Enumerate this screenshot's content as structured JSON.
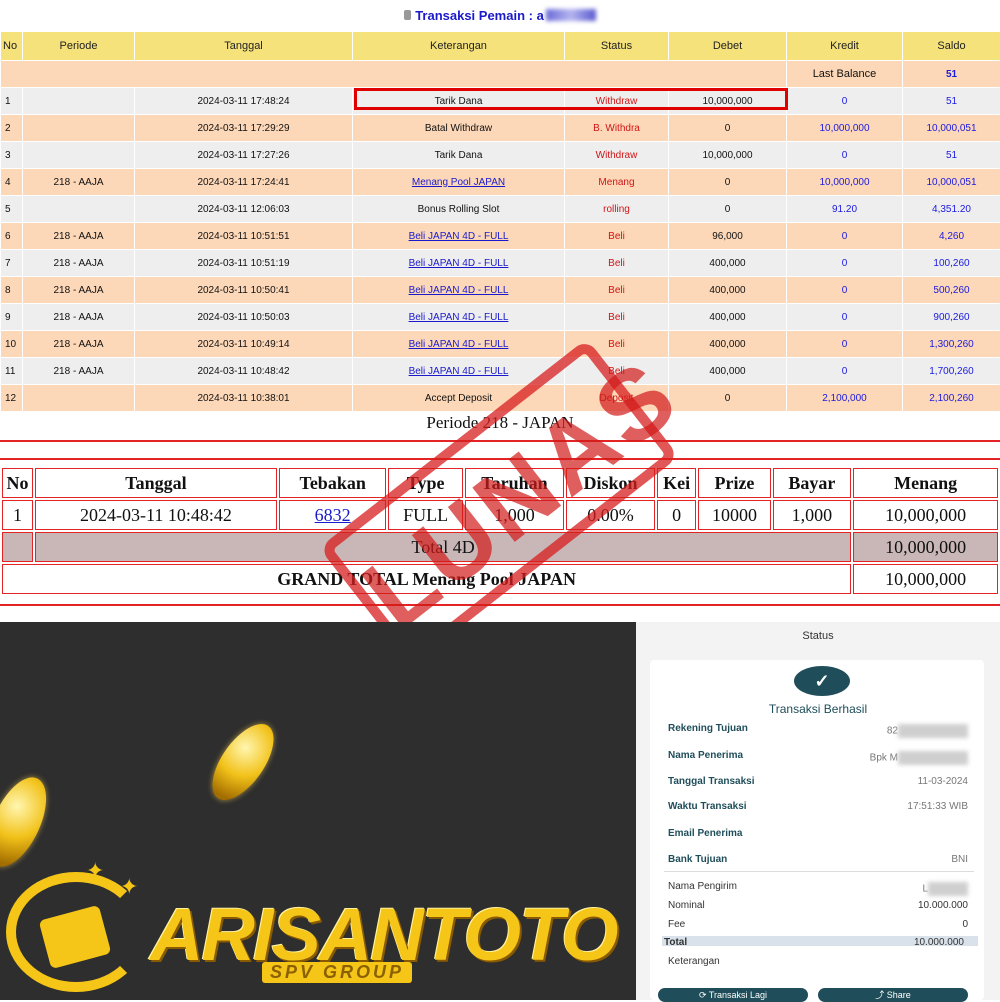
{
  "top": {
    "title": "Transaksi  Pemain : a",
    "headers": [
      "No",
      "Periode",
      "Tanggal",
      "Keterangan",
      "Status",
      "Debet",
      "Kredit",
      "Saldo"
    ],
    "last_balance_label": "Last Balance",
    "last_balance_value": "51",
    "rows": [
      {
        "no": "1",
        "periode": "",
        "tanggal": "2024-03-11 17:48:24",
        "ket": "Tarik Dana",
        "status": "Withdraw",
        "debet": "10,000,000",
        "kredit": "0",
        "saldo": "51",
        "link": false
      },
      {
        "no": "2",
        "periode": "",
        "tanggal": "2024-03-11 17:29:29",
        "ket": "Batal Withdraw",
        "status": "B. Withdra",
        "debet": "0",
        "kredit": "10,000,000",
        "saldo": "10,000,051",
        "link": false
      },
      {
        "no": "3",
        "periode": "",
        "tanggal": "2024-03-11 17:27:26",
        "ket": "Tarik Dana",
        "status": "Withdraw",
        "debet": "10,000,000",
        "kredit": "0",
        "saldo": "51",
        "link": false
      },
      {
        "no": "4",
        "periode": "218 - AAJA",
        "tanggal": "2024-03-11 17:24:41",
        "ket": "Menang Pool JAPAN",
        "status": "Menang",
        "debet": "0",
        "kredit": "10,000,000",
        "saldo": "10,000,051",
        "link": true
      },
      {
        "no": "5",
        "periode": "",
        "tanggal": "2024-03-11 12:06:03",
        "ket": "Bonus Rolling Slot",
        "status": "rolling",
        "debet": "0",
        "kredit": "91.20",
        "saldo": "4,351.20",
        "link": false
      },
      {
        "no": "6",
        "periode": "218 - AAJA",
        "tanggal": "2024-03-11 10:51:51",
        "ket": "Beli JAPAN 4D - FULL",
        "status": "Beli",
        "debet": "96,000",
        "kredit": "0",
        "saldo": "4,260",
        "link": true
      },
      {
        "no": "7",
        "periode": "218 - AAJA",
        "tanggal": "2024-03-11 10:51:19",
        "ket": "Beli JAPAN 4D - FULL",
        "status": "Beli",
        "debet": "400,000",
        "kredit": "0",
        "saldo": "100,260",
        "link": true
      },
      {
        "no": "8",
        "periode": "218 - AAJA",
        "tanggal": "2024-03-11 10:50:41",
        "ket": "Beli JAPAN 4D - FULL",
        "status": "Beli",
        "debet": "400,000",
        "kredit": "0",
        "saldo": "500,260",
        "link": true
      },
      {
        "no": "9",
        "periode": "218 - AAJA",
        "tanggal": "2024-03-11 10:50:03",
        "ket": "Beli JAPAN 4D - FULL",
        "status": "Beli",
        "debet": "400,000",
        "kredit": "0",
        "saldo": "900,260",
        "link": true
      },
      {
        "no": "10",
        "periode": "218 - AAJA",
        "tanggal": "2024-03-11 10:49:14",
        "ket": "Beli JAPAN 4D - FULL",
        "status": "Beli",
        "debet": "400,000",
        "kredit": "0",
        "saldo": "1,300,260",
        "link": true
      },
      {
        "no": "11",
        "periode": "218 - AAJA",
        "tanggal": "2024-03-11 10:48:42",
        "ket": "Beli JAPAN 4D - FULL",
        "status": "Beli",
        "debet": "400,000",
        "kredit": "0",
        "saldo": "1,700,260",
        "link": true
      },
      {
        "no": "12",
        "periode": "",
        "tanggal": "2024-03-11 10:38:01",
        "ket": "Accept Deposit",
        "status": "Deposit",
        "debet": "0",
        "kredit": "2,100,000",
        "saldo": "2,100,260",
        "link": false
      }
    ]
  },
  "periode": {
    "title": "Periode 218 - JAPAN",
    "headers": [
      "No",
      "Tanggal",
      "Tebakan",
      "Type",
      "Taruhan",
      "Diskon",
      "Kei",
      "Prize",
      "Bayar",
      "Menang"
    ],
    "row": {
      "no": "1",
      "tanggal": "2024-03-11 10:48:42",
      "tebakan": "6832",
      "type": "FULL",
      "taruhan": "1,000",
      "diskon": "0.00%",
      "kei": "0",
      "prize": "10000",
      "bayar": "1,000",
      "menang": "10,000,000"
    },
    "total_label": "Total 4D",
    "total_value": "10,000,000",
    "grand_label": "GRAND TOTAL  Menang Pool JAPAN",
    "grand_value": "10,000,000",
    "stamp_text": "LUNAS"
  },
  "banner": {
    "brand": "ARISANTOTO",
    "sub": "SPV GROUP",
    "brand_color": "#f5c518"
  },
  "receipt": {
    "header": "Status",
    "success": "Transaksi Berhasil",
    "fields": [
      {
        "k": "Rekening Tujuan",
        "v": "82"
      },
      {
        "k": "Nama Penerima",
        "v": "Bpk M"
      },
      {
        "k": "Tanggal Transaksi",
        "v": "11-03-2024"
      },
      {
        "k": "Waktu Transaksi",
        "v": "17:51:33 WIB"
      },
      {
        "k": "Email Penerima",
        "v": ""
      },
      {
        "k": "Bank Tujuan",
        "v": "BNI"
      }
    ],
    "sender_label": "Nama Pengirim",
    "sender_value": "L",
    "nominal_label": "Nominal",
    "nominal_value": "10.000.000",
    "fee_label": "Fee",
    "fee_value": "0",
    "total_label": "Total",
    "total_value": "10.000.000",
    "keterangan_label": "Keterangan",
    "btn_left": "Transaksi Lagi",
    "btn_right": "Share",
    "accent": "#1f4e5a"
  }
}
